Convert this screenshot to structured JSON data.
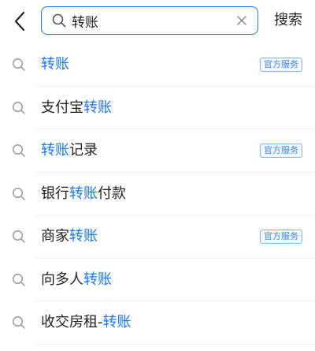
{
  "header": {
    "search_value": "转账",
    "search_button_label": "搜索"
  },
  "suggestions": [
    {
      "pre": "",
      "hl": "转账",
      "post": "",
      "badge": "官方服务"
    },
    {
      "pre": "支付宝",
      "hl": "转账",
      "post": "",
      "badge": ""
    },
    {
      "pre": "",
      "hl": "转账",
      "post": "记录",
      "badge": "官方服务"
    },
    {
      "pre": "银行",
      "hl": "转账",
      "post": "付款",
      "badge": ""
    },
    {
      "pre": "商家",
      "hl": "转账",
      "post": "",
      "badge": "官方服务"
    },
    {
      "pre": "向多人",
      "hl": "转账",
      "post": "",
      "badge": ""
    },
    {
      "pre": "收交房租-",
      "hl": "转账",
      "post": "",
      "badge": ""
    }
  ],
  "colors": {
    "accent": "#1677ff",
    "text": "#222222",
    "icon": "#9a9a9a"
  }
}
